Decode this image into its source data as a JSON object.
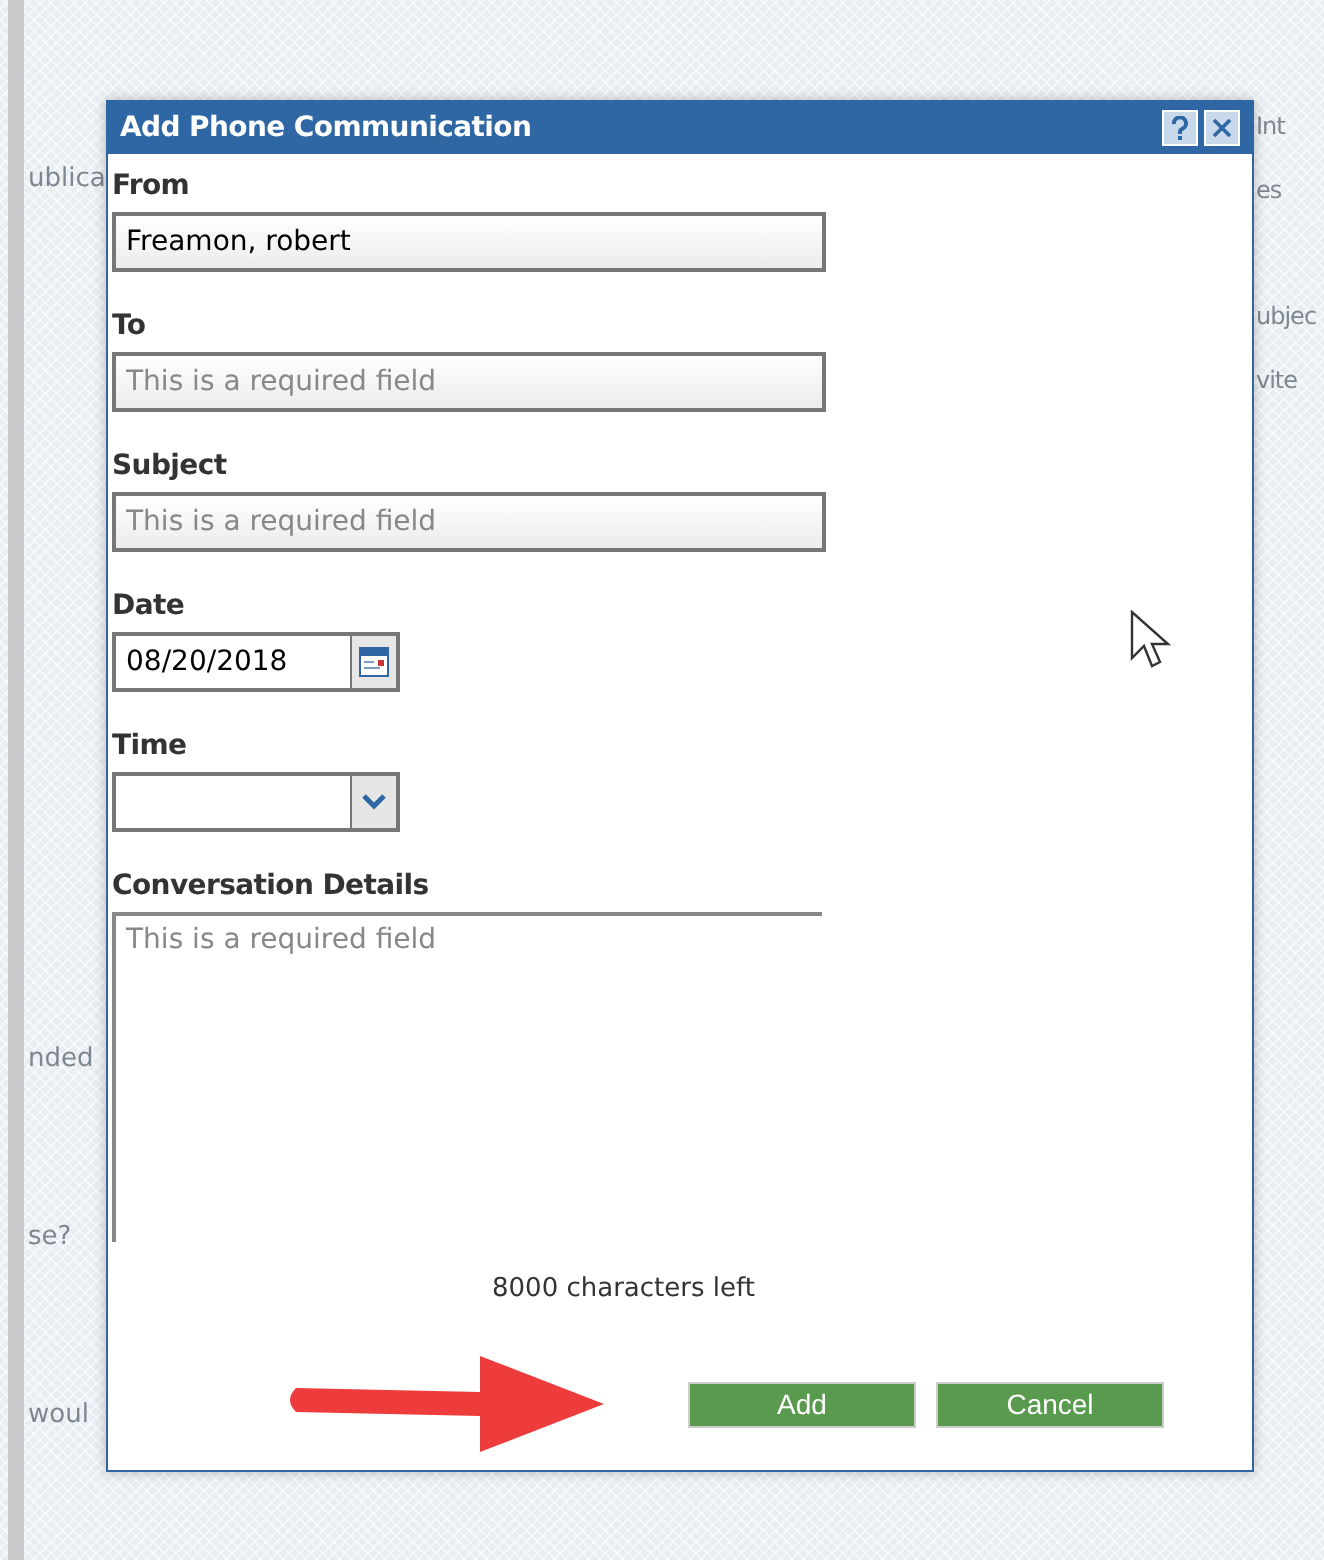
{
  "background_fragments": {
    "left": [
      "ublica",
      "nded",
      "se?",
      "woul"
    ],
    "right": [
      "Int",
      "es",
      "ubjec",
      "vite"
    ]
  },
  "dialog": {
    "title": "Add Phone Communication",
    "fields": [
      {
        "kind": "text",
        "label": "From",
        "value": "Freamon, robert"
      },
      {
        "kind": "text",
        "label": "To",
        "placeholder": "This is a required field"
      },
      {
        "kind": "text",
        "label": "Subject",
        "placeholder": "This is a required field"
      },
      {
        "kind": "date",
        "label": "Date",
        "value": "08/20/2018"
      },
      {
        "kind": "select",
        "label": "Time"
      },
      {
        "kind": "textarea",
        "label": "Conversation Details",
        "placeholder": "This is a required field"
      }
    ],
    "char_count": "8000 characters left",
    "buttons": [
      "Add",
      "Cancel"
    ]
  }
}
